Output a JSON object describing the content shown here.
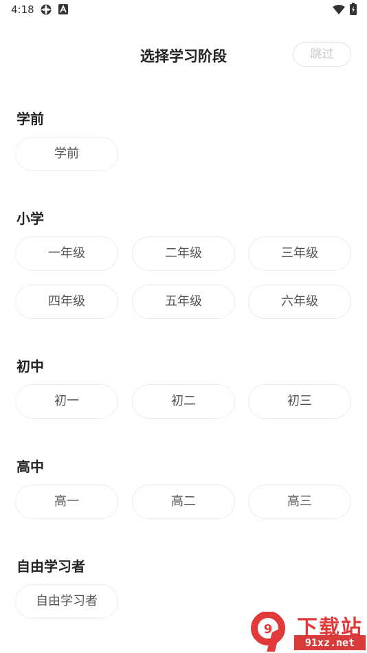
{
  "status_bar": {
    "time": "4:18",
    "icons_left": [
      "settings-gear-icon",
      "a-letter-icon"
    ],
    "icons_right": [
      "wifi-icon",
      "battery-icon"
    ]
  },
  "header": {
    "title": "选择学习阶段",
    "skip_label": "跳过"
  },
  "sections": {
    "preschool": {
      "title": "学前",
      "options": [
        "学前"
      ]
    },
    "primary": {
      "title": "小学",
      "options": [
        "一年级",
        "二年级",
        "三年级",
        "四年级",
        "五年级",
        "六年级"
      ]
    },
    "junior": {
      "title": "初中",
      "options": [
        "初一",
        "初二",
        "初三"
      ]
    },
    "senior": {
      "title": "高中",
      "options": [
        "高一",
        "高二",
        "高三"
      ]
    },
    "free": {
      "title": "自由学习者",
      "options": [
        "自由学习者"
      ]
    }
  },
  "watermark": {
    "logo_char": "9",
    "brand_name": "下载站",
    "site": "91xz.net",
    "colors": {
      "red": "#e23a3a"
    }
  },
  "colors": {
    "option_border": "#ececec",
    "option_text": "#555555",
    "skip_text": "#c8c8c8",
    "title_text": "#222222"
  }
}
